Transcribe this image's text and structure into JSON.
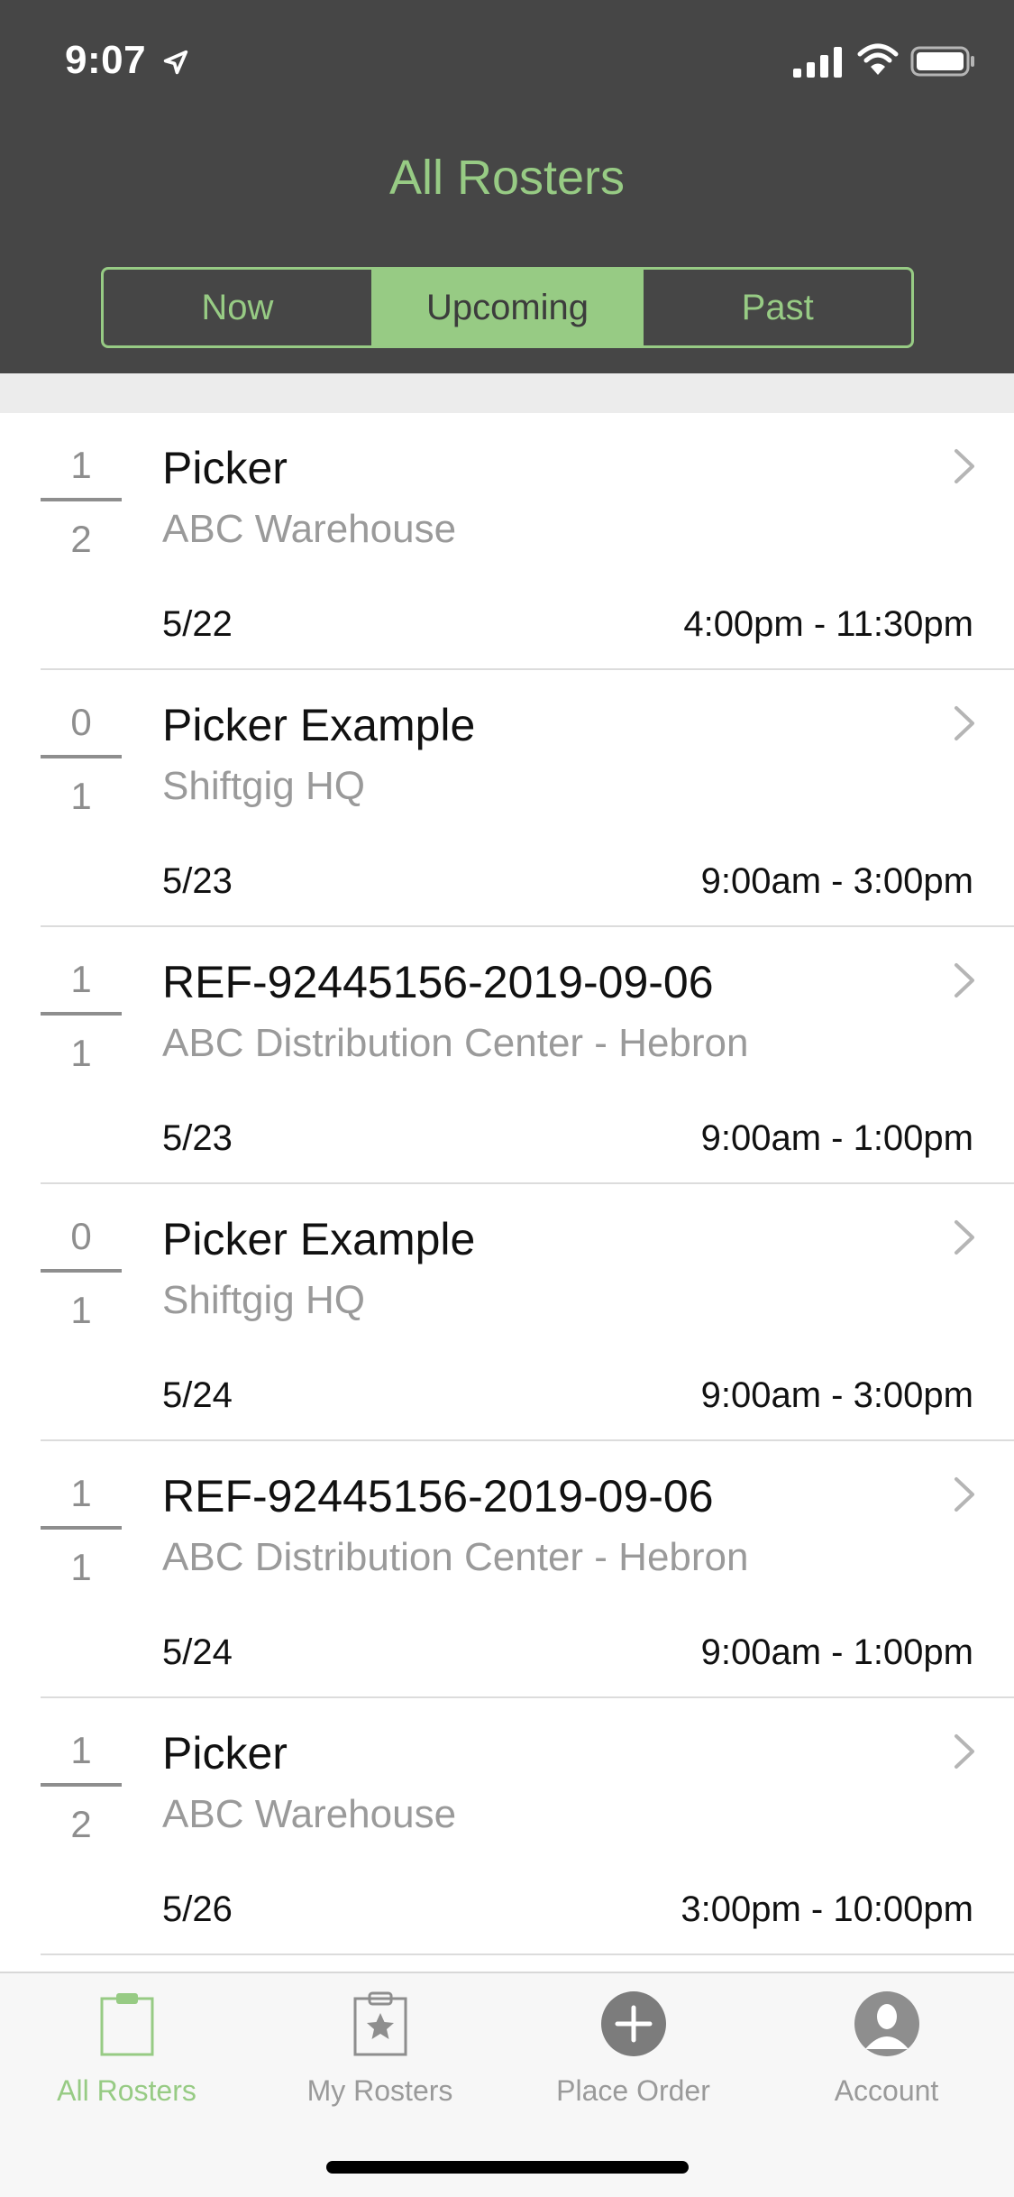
{
  "status_bar": {
    "time": "9:07"
  },
  "header": {
    "title": "All Rosters",
    "segments": [
      {
        "label": "Now",
        "active": false
      },
      {
        "label": "Upcoming",
        "active": true
      },
      {
        "label": "Past",
        "active": false
      }
    ]
  },
  "rosters": [
    {
      "filled": "1",
      "total": "2",
      "title": "Picker",
      "location": "ABC Warehouse",
      "date": "5/22",
      "time": "4:00pm - 11:30pm"
    },
    {
      "filled": "0",
      "total": "1",
      "title": "Picker Example",
      "location": "Shiftgig HQ",
      "date": "5/23",
      "time": "9:00am - 3:00pm"
    },
    {
      "filled": "1",
      "total": "1",
      "title": "REF-92445156-2019-09-06",
      "location": "ABC Distribution Center - Hebron",
      "date": "5/23",
      "time": "9:00am - 1:00pm"
    },
    {
      "filled": "0",
      "total": "1",
      "title": "Picker Example",
      "location": "Shiftgig HQ",
      "date": "5/24",
      "time": "9:00am - 3:00pm"
    },
    {
      "filled": "1",
      "total": "1",
      "title": "REF-92445156-2019-09-06",
      "location": "ABC Distribution Center - Hebron",
      "date": "5/24",
      "time": "9:00am - 1:00pm"
    },
    {
      "filled": "1",
      "total": "2",
      "title": "Picker",
      "location": "ABC Warehouse",
      "date": "5/26",
      "time": "3:00pm - 10:00pm"
    }
  ],
  "tabbar": {
    "items": [
      {
        "label": "All Rosters",
        "icon": "clipboard-icon",
        "active": true
      },
      {
        "label": "My Rosters",
        "icon": "clipboard-star-icon",
        "active": false
      },
      {
        "label": "Place Order",
        "icon": "plus-circle-icon",
        "active": false
      },
      {
        "label": "Account",
        "icon": "person-icon",
        "active": false
      }
    ]
  },
  "colors": {
    "accent": "#97cb84",
    "header_bg": "#464646"
  }
}
